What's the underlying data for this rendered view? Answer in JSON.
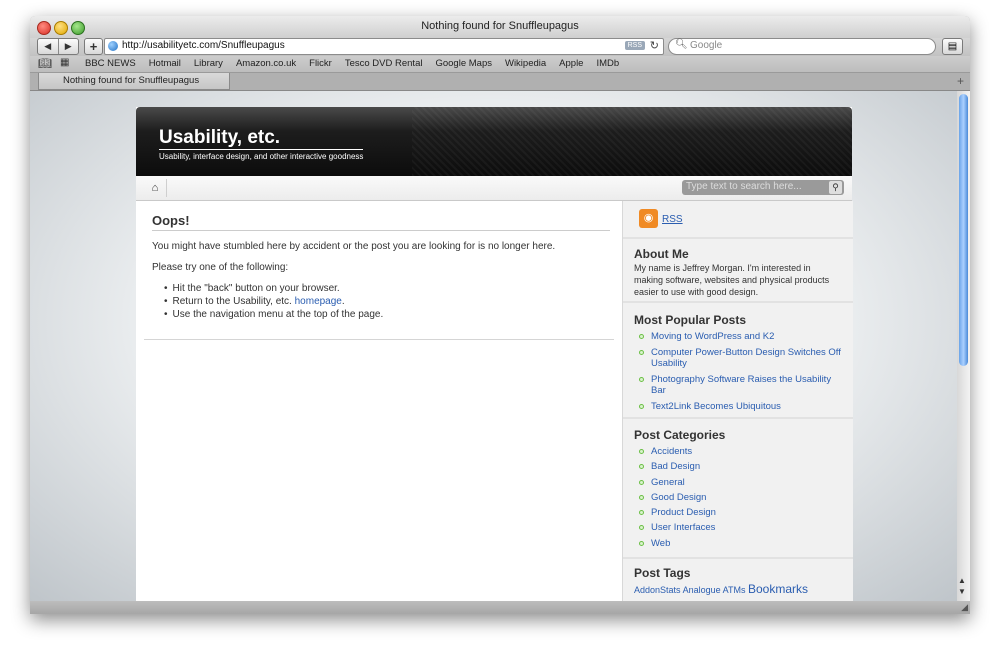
{
  "window": {
    "title": "Nothing found for Snuffleupagus"
  },
  "toolbar": {
    "back_label": "◀",
    "forward_label": "▶",
    "add_label": "+",
    "url": "http://usabilityetc.com/Snuffleupagus",
    "rss_badge": "RSS",
    "reload_label": "↻",
    "search_placeholder": "Google",
    "print_label": "▤"
  },
  "bookmarks": {
    "items": [
      "BBC NEWS",
      "Hotmail",
      "Library",
      "Amazon.co.uk",
      "Flickr",
      "Tesco DVD Rental",
      "Google Maps",
      "Wikipedia",
      "Apple",
      "IMDb"
    ]
  },
  "tabs": [
    {
      "label": "Nothing found for Snuffleupagus"
    }
  ],
  "site": {
    "title": "Usability, etc.",
    "description": "Usability, interface design, and other interactive goodness",
    "search_placeholder": "Type text to search here...",
    "home_glyph": "⌂"
  },
  "main": {
    "heading": "Oops!",
    "p1": "You might have stumbled here by accident or the post you are looking for is no longer here.",
    "p2": "Please try one of the following:",
    "item1": "Hit the \"back\" button on your browser.",
    "item2_before": "Return to the Usability, etc. ",
    "item2_link": "homepage",
    "item2_after": ".",
    "item3": "Use the navigation menu at the top of the page."
  },
  "sidebar": {
    "rss_label": "RSS",
    "about_title": "About Me",
    "about_text": "My name is Jeffrey Morgan. I'm interested in making software, websites and physical products easier to use with good design.",
    "popular_title": "Most Popular Posts",
    "popular": [
      "Moving to WordPress and K2",
      "Computer Power-Button Design Switches Off Usability",
      "Photography Software Raises the Usability Bar",
      "Text2Link Becomes Ubiquitous"
    ],
    "categories_title": "Post Categories",
    "categories": [
      "Accidents",
      "Bad Design",
      "General",
      "Good Design",
      "Product Design",
      "User Interfaces",
      "Web"
    ],
    "tags_title": "Post Tags",
    "tags": [
      "AddonStats",
      "Analogue",
      "ATMs",
      "Bookmarks"
    ]
  }
}
